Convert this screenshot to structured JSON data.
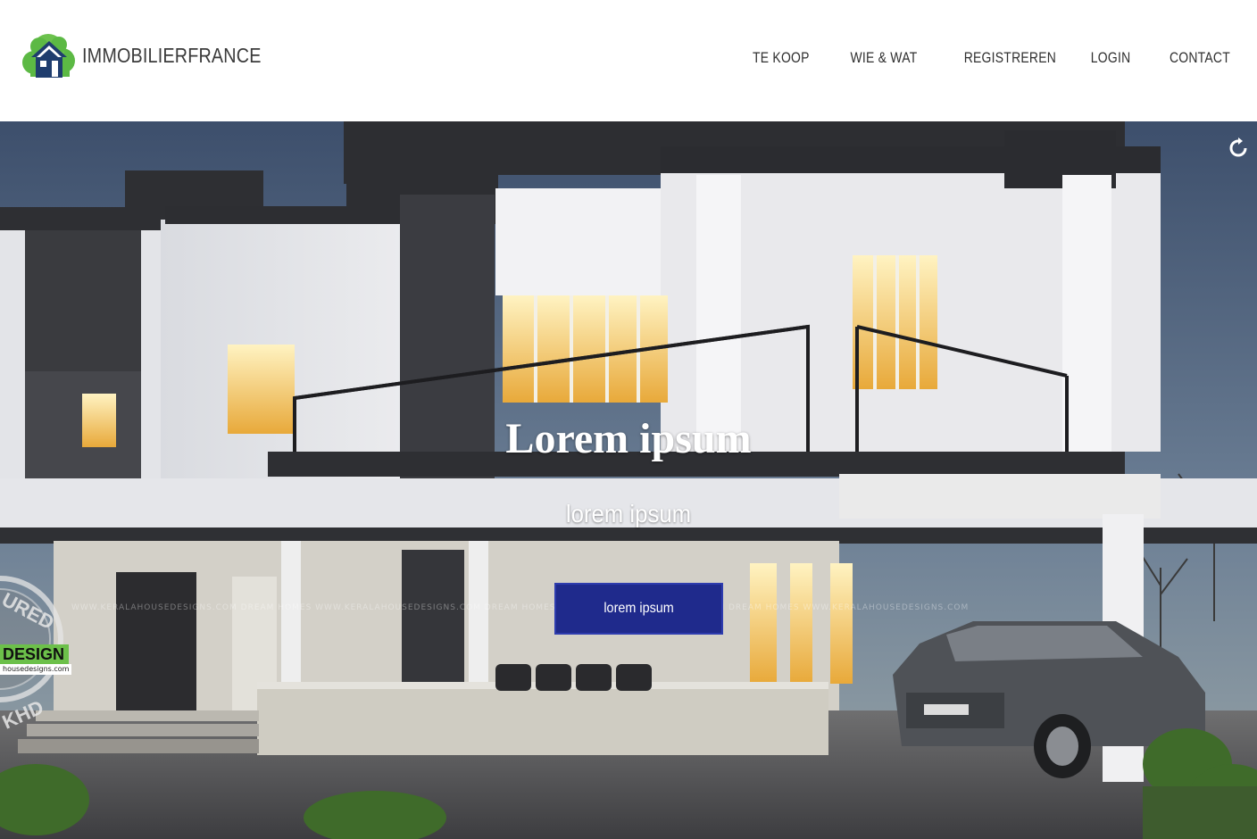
{
  "brand": {
    "name": "IMMOBILIERFRANCE",
    "icon": "house-tree-icon",
    "colors": {
      "green": "#5cb944",
      "navy": "#1f3d6e"
    }
  },
  "nav": {
    "items": [
      {
        "label": "TE KOOP"
      },
      {
        "label": "WIE & WAT"
      },
      {
        "label": "REGISTREREN"
      },
      {
        "label": "LOGIN"
      },
      {
        "label": "CONTACT"
      }
    ]
  },
  "hero": {
    "title": "Lorem ipsum",
    "subtitle": "lorem ipsum",
    "button_label": "lorem ipsum",
    "button_color": "#1f2a8c",
    "reload_icon": "reload-icon",
    "watermark": "WWW.KERALAHOUSEDESIGNS.COM        DREAM HOMES        WWW.KERALAHOUSEDESIGNS.COM        DREAM HOMES        WWW.KERALAHOUSEDESIGNS.COM        DREAM HOMES        WWW.KERALAHOUSEDESIGNS.COM",
    "badge": {
      "top": "URED",
      "middle": "DESIGN",
      "url": "housedesigns.com",
      "bottom": "KHD"
    }
  }
}
